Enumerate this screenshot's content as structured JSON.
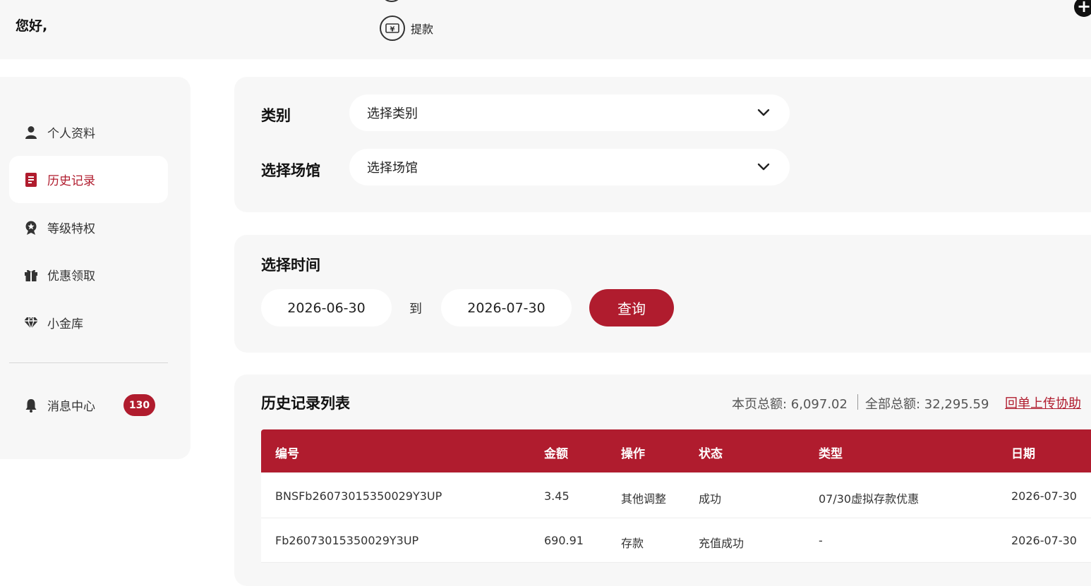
{
  "header": {
    "greeting": "您好, ",
    "withdraw_label": "提款",
    "plus_symbol": "+"
  },
  "sidebar": {
    "items": [
      {
        "label": "个人资料",
        "icon": "user-icon"
      },
      {
        "label": "历史记录",
        "icon": "document-icon",
        "active": true
      },
      {
        "label": "等级特权",
        "icon": "medal-icon"
      },
      {
        "label": "优惠领取",
        "icon": "gift-icon"
      },
      {
        "label": "小金库",
        "icon": "diamond-icon"
      }
    ],
    "messages": {
      "label": "消息中心",
      "icon": "bell-icon",
      "count": "130"
    }
  },
  "filters": {
    "category_label": "类别",
    "category_value": "选择类别",
    "venue_label": "选择场馆",
    "venue_value": "选择场馆"
  },
  "time": {
    "label": "选择时间",
    "start": "2026-06-30",
    "to": "到",
    "end": "2026-07-30",
    "query_button": "查询"
  },
  "list": {
    "title": "历史记录列表",
    "page_total": "本页总额: 6,097.02",
    "all_total": "全部总额: 32,295.59",
    "upload_link": "回单上传协助",
    "columns": [
      "编号",
      "金额",
      "操作",
      "状态",
      "类型",
      "日期"
    ],
    "rows": [
      [
        "BNSFb26073015350029Y3UP",
        "3.45",
        "其他调整",
        "成功",
        "07/30虚拟存款优惠",
        "2026-07-30"
      ],
      [
        "Fb26073015350029Y3UP",
        "690.91",
        "存款",
        "充值成功",
        "-",
        "2026-07-30"
      ]
    ]
  },
  "colors": {
    "accent": "#b01c2e",
    "panel_bg": "#f7f7f7"
  }
}
